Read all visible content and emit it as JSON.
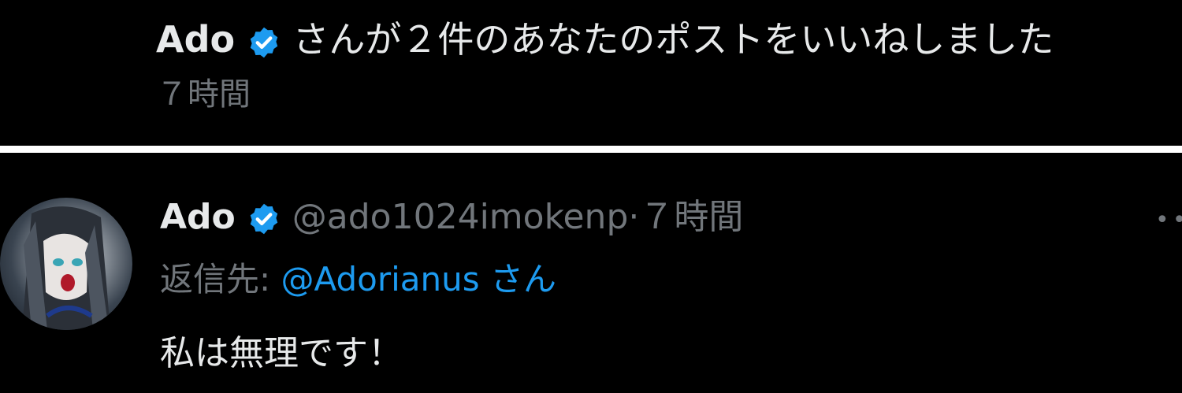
{
  "notification": {
    "user_name": "Ado",
    "action_text": "さんが２件のあなたのポストをいいねしました",
    "time": "７時間"
  },
  "tweet": {
    "user_name": "Ado",
    "handle": "@ado1024imokenp",
    "separator": "·",
    "time": "７時間",
    "reply_label": "返信先:",
    "reply_to": "@Adorianus",
    "reply_suffix": "さん",
    "body": "私は無理です！"
  },
  "icons": {
    "verified": "verified-badge-icon",
    "more": "more-options-icon",
    "avatar": "avatar"
  },
  "colors": {
    "background": "#000000",
    "primary_text": "#e7e9ea",
    "secondary_text": "#71767b",
    "accent": "#1d9bf0",
    "separator": "#ffffff"
  }
}
